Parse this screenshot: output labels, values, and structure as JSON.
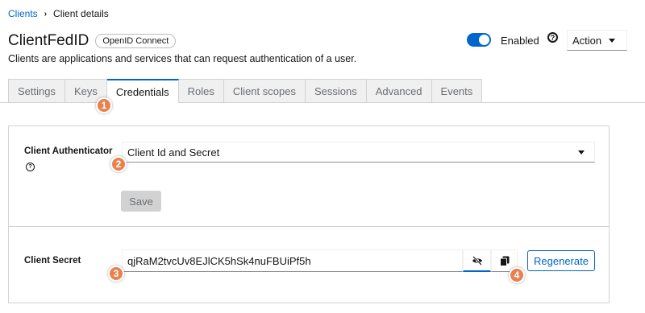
{
  "breadcrumb": {
    "parent": "Clients",
    "separator": "›",
    "current": "Client details"
  },
  "header": {
    "title": "ClientFedID",
    "protocol_badge": "OpenID Connect",
    "subtitle": "Clients are applications and services that can request authentication of a user.",
    "enabled_label": "Enabled",
    "enabled": true,
    "help_glyph": "?",
    "action_label": "Action"
  },
  "tabs": [
    {
      "label": "Settings",
      "active": false
    },
    {
      "label": "Keys",
      "active": false
    },
    {
      "label": "Credentials",
      "active": true
    },
    {
      "label": "Roles",
      "active": false
    },
    {
      "label": "Client scopes",
      "active": false
    },
    {
      "label": "Sessions",
      "active": false
    },
    {
      "label": "Advanced",
      "active": false
    },
    {
      "label": "Events",
      "active": false
    }
  ],
  "markers": [
    "1",
    "2",
    "3",
    "4"
  ],
  "credentials": {
    "authenticator_label": "Client Authenticator",
    "authenticator_value": "Client Id and Secret",
    "help_glyph": "?",
    "save_label": "Save",
    "secret_label": "Client Secret",
    "secret_value": "qjRaM2tvcUv8EJlCK5hSk4nuFBUiPf5h",
    "regenerate_label": "Regenerate"
  },
  "colors": {
    "accent": "#0066cc",
    "marker": "#e8814d",
    "disabled": "#d2d2d2"
  }
}
